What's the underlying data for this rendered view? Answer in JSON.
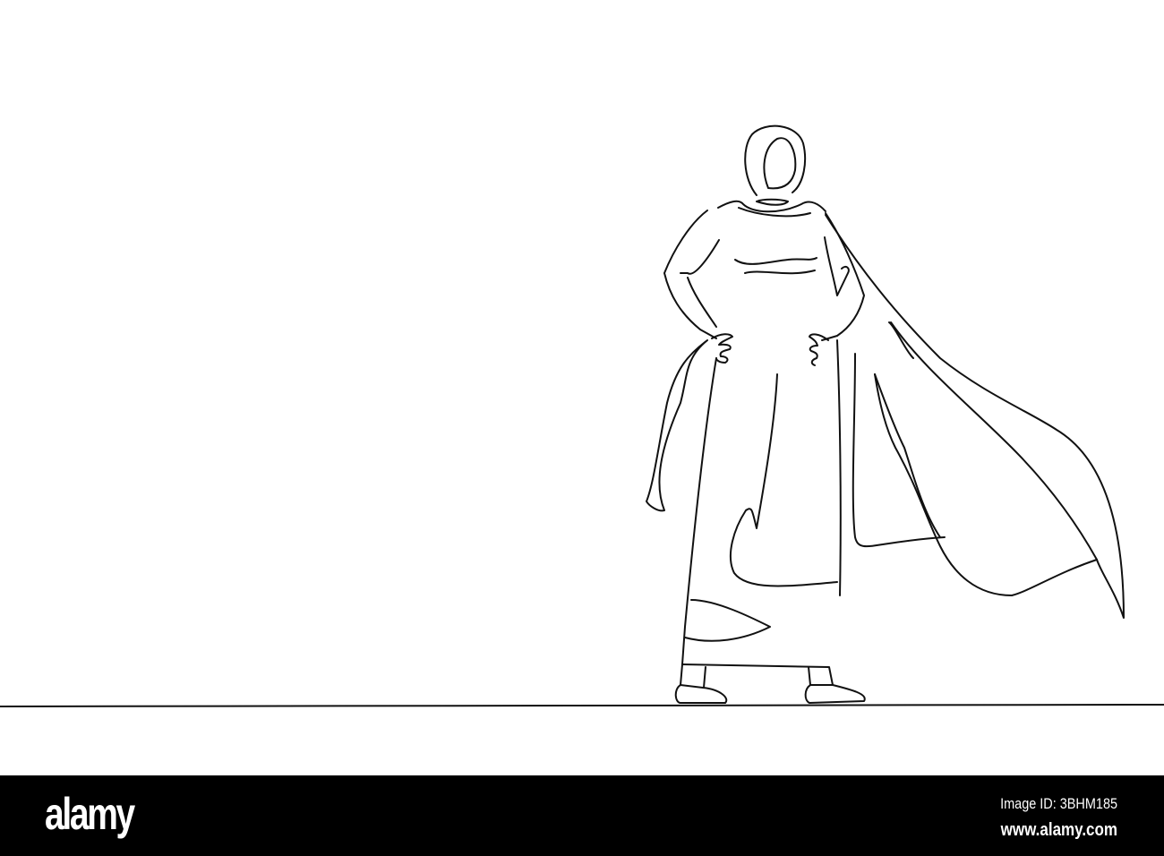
{
  "footer": {
    "logo": "alamy",
    "image_id": "Image ID: 3BHM185",
    "website": "www.alamy.com"
  },
  "colors": {
    "footer_bg": "#000000",
    "line": "#111111",
    "background": "#ffffff"
  }
}
